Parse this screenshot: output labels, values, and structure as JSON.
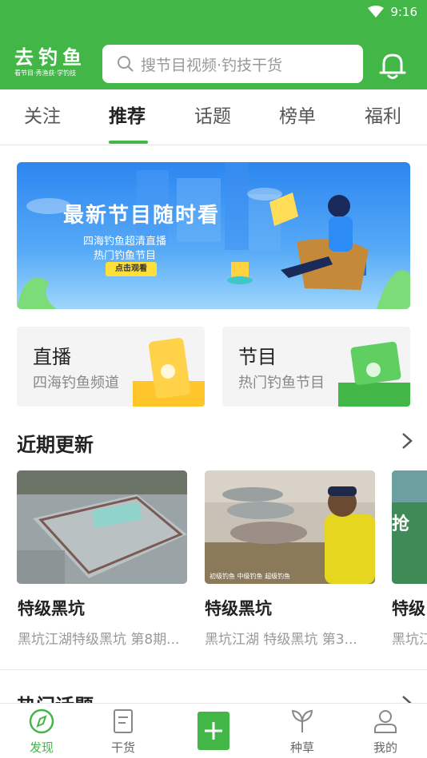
{
  "status": {
    "time": "9:16"
  },
  "header": {
    "logo_title": "去钓鱼",
    "logo_subtitle": "看节目·秀渔获·学钓技",
    "search_placeholder": "搜节目视频·钓技干货"
  },
  "tabs": [
    {
      "label": "关注",
      "active": false
    },
    {
      "label": "推荐",
      "active": true
    },
    {
      "label": "话题",
      "active": false
    },
    {
      "label": "榜单",
      "active": false
    },
    {
      "label": "福利",
      "active": false
    }
  ],
  "banner": {
    "title": "最新节目随时看",
    "line1": "四海钓鱼超清直播",
    "line2": "热门钓鱼节目",
    "button": "点击观看"
  },
  "entries": [
    {
      "title": "直播",
      "subtitle": "四海钓鱼频道",
      "accent": "#ffc52b"
    },
    {
      "title": "节目",
      "subtitle": "热门钓鱼节目",
      "accent": "#43b648"
    }
  ],
  "recent": {
    "title": "近期更新",
    "items": [
      {
        "title": "特级黑坑",
        "subtitle": "黑坑江湖特级黑坑 第8期..."
      },
      {
        "title": "特级黑坑",
        "subtitle": "黑坑江湖 特级黑坑 第3...",
        "overlay": "初级钓鱼   中级钓鱼   超级钓鱼"
      },
      {
        "title": "特级",
        "subtitle": "黑坑江",
        "overlay": "抢"
      }
    ]
  },
  "hot_topics": {
    "title": "热门话题"
  },
  "bottom_nav": [
    {
      "label": "发现",
      "icon": "compass-icon",
      "active": true
    },
    {
      "label": "干货",
      "icon": "document-icon",
      "active": false
    },
    {
      "label": "",
      "icon": "plus-icon",
      "active": false
    },
    {
      "label": "种草",
      "icon": "sprout-icon",
      "active": false
    },
    {
      "label": "我的",
      "icon": "user-icon",
      "active": false
    }
  ],
  "colors": {
    "brand": "#43b648",
    "tab_indicator": "#43b648"
  }
}
